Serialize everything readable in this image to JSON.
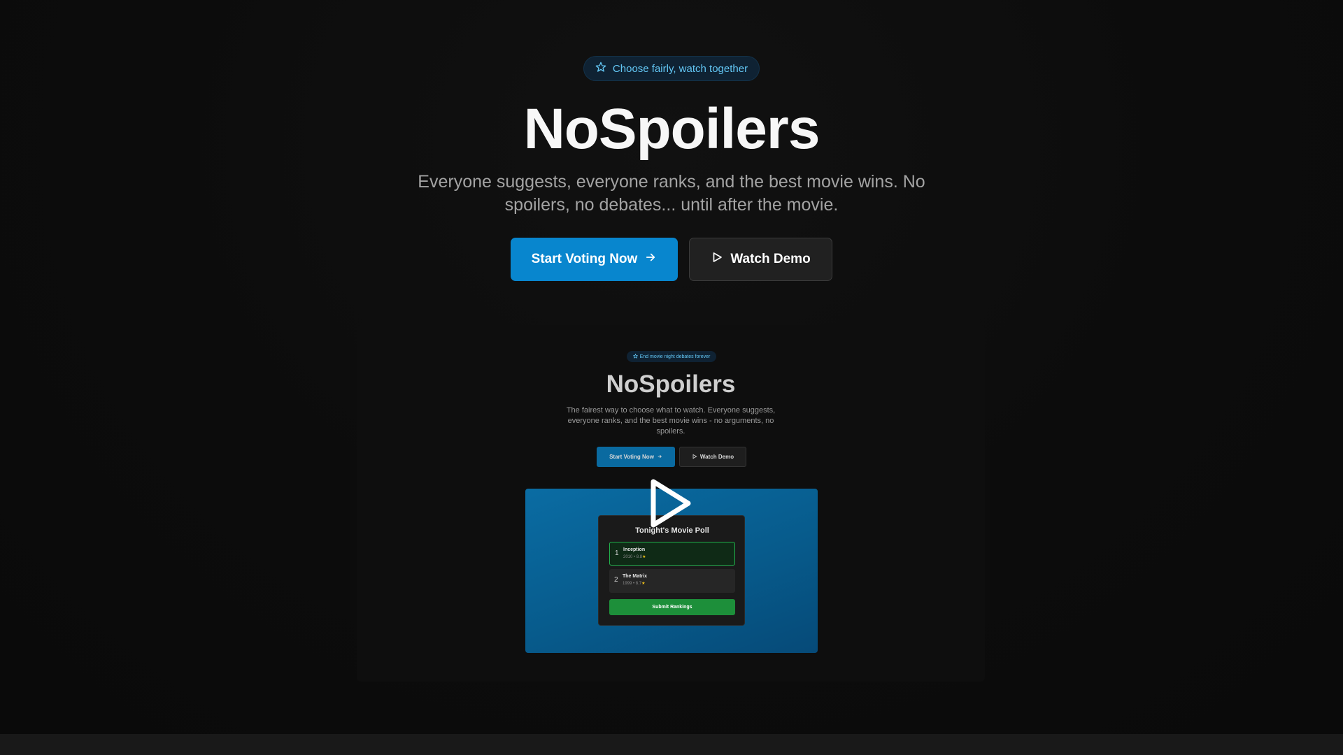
{
  "badge": {
    "icon": "star-icon",
    "text": "Choose fairly, watch together"
  },
  "hero": {
    "title": "NoSpoilers",
    "subtitle": "Everyone suggests, everyone ranks, and the best movie wins. No spoilers, no debates... until after the movie."
  },
  "buttons": {
    "primary": {
      "label": "Start Voting Now",
      "icon": "arrow-right-icon"
    },
    "secondary": {
      "label": "Watch Demo",
      "icon": "play-icon"
    }
  },
  "demo": {
    "badge": "End movie night debates forever",
    "title": "NoSpoilers",
    "subtitle": "The fairest way to choose what to watch. Everyone suggests, everyone ranks, and the best movie wins - no arguments, no spoilers.",
    "primary_label": "Start Voting Now",
    "secondary_label": "Watch Demo",
    "poll": {
      "title": "Tonight's Movie Poll",
      "items": [
        {
          "rank": "1",
          "name": "Inception",
          "meta": "2010 • 8.8"
        },
        {
          "rank": "2",
          "name": "The Matrix",
          "meta": "1999 • 8.7"
        }
      ],
      "submit_label": "Submit Rankings"
    }
  },
  "colors": {
    "accent": "#0886ce",
    "badge_text": "#63c7f5",
    "success": "#1d8f3a",
    "background": "#0b0b0b"
  }
}
